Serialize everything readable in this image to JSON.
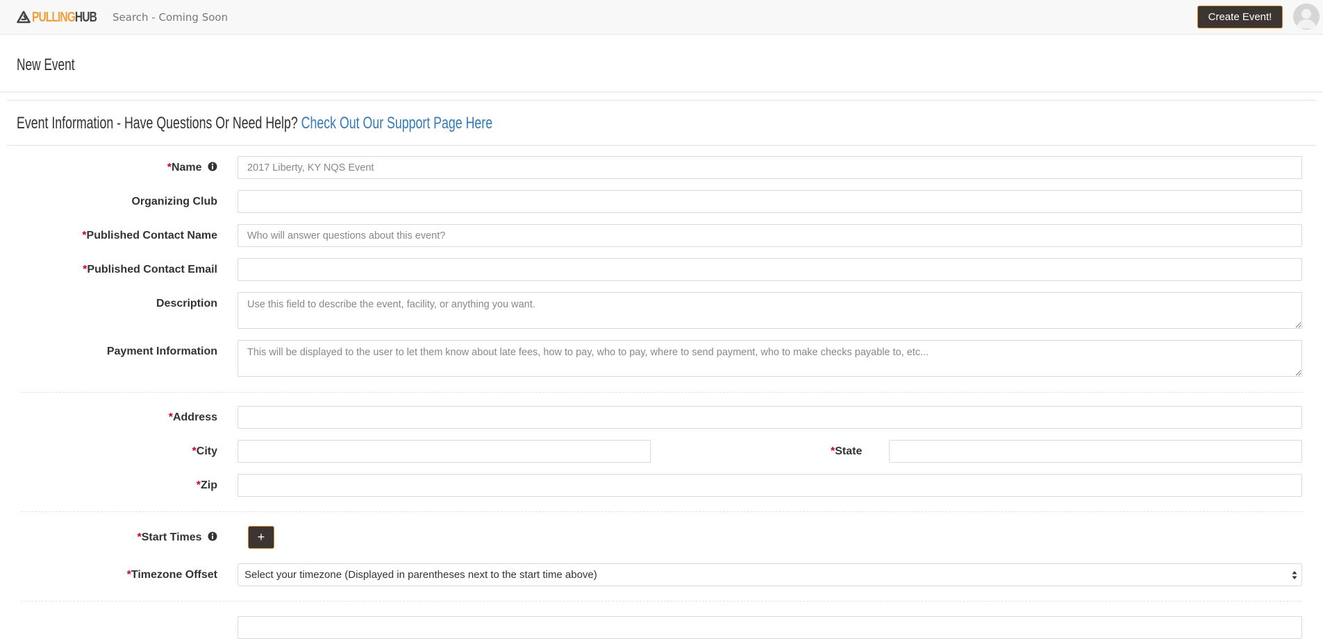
{
  "navbar": {
    "logo": {
      "part1": "PULLING",
      "part2": "HUB"
    },
    "search_text": "Search - Coming Soon",
    "create_event_label": "Create Event!"
  },
  "page": {
    "title": "New Event"
  },
  "section": {
    "title": "Event Information - Have Questions Or Need Help?",
    "link": "Check Out Our Support Page Here"
  },
  "form": {
    "required_mark": "*",
    "name": {
      "label": "Name",
      "placeholder": "2017 Liberty, KY NQS Event",
      "value": ""
    },
    "organizing_club": {
      "label": "Organizing Club",
      "value": ""
    },
    "contact_name": {
      "label": "Published Contact Name",
      "placeholder": "Who will answer questions about this event?",
      "value": ""
    },
    "contact_email": {
      "label": "Published Contact Email",
      "value": ""
    },
    "description": {
      "label": "Description",
      "placeholder": "Use this field to describe the event, facility, or anything you want.",
      "value": ""
    },
    "payment_info": {
      "label": "Payment Information",
      "placeholder": "This will be displayed to the user to let them know about late fees, how to pay, who to pay, where to send payment, who to make checks payable to, etc...",
      "value": ""
    },
    "address": {
      "label": "Address",
      "value": ""
    },
    "city": {
      "label": "City",
      "value": ""
    },
    "state": {
      "label": "State",
      "value": ""
    },
    "zip": {
      "label": "Zip",
      "value": ""
    },
    "start_times": {
      "label": "Start Times",
      "add_label": "+"
    },
    "timezone": {
      "label": "Timezone Offset",
      "selected": "Select your timezone (Displayed in parentheses next to the start time above)"
    }
  },
  "colors": {
    "accent": "#f0a03a",
    "button_bg": "#3c3532",
    "link": "#337ab7",
    "required": "#d0021b"
  },
  "icons": [
    "logo-mark-icon",
    "info-icon",
    "avatar-icon",
    "select-arrows-icon"
  ]
}
